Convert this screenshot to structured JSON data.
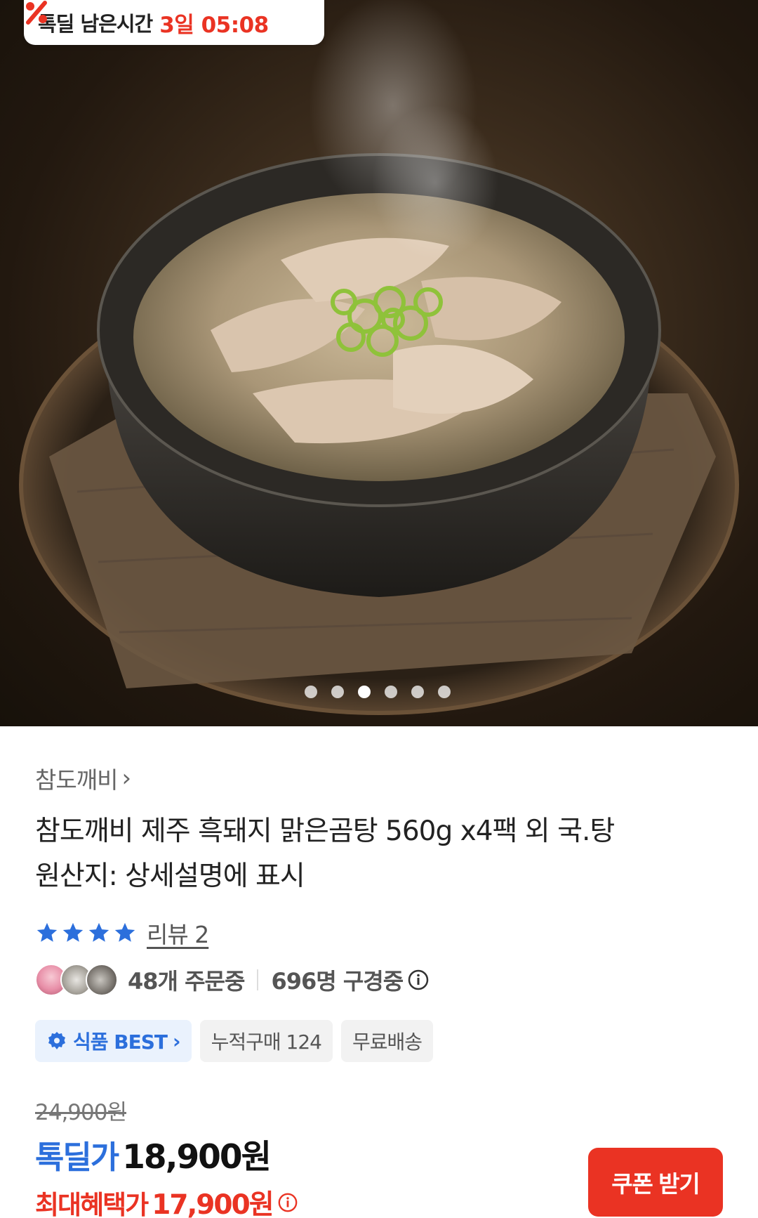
{
  "deal_timer": {
    "label": "톡딜 남은시간",
    "countdown": "3일 05:08",
    "icon": "percent-icon"
  },
  "carousel": {
    "image_alt": "clear pork soup with sliced pork and green onion in a dark bowl",
    "dot_count": 6,
    "active_index": 2
  },
  "product": {
    "seller": "참도깨비",
    "title": "참도깨비 제주 흑돼지 맑은곰탕 560g x4팩 외 국.탕",
    "origin": "원산지: 상세설명에 표시",
    "rating_stars": 4,
    "review_label": "리뷰 2"
  },
  "social_proof": {
    "orders": "48개 주문중",
    "viewers": "696명 구경중"
  },
  "badges": {
    "best": "식품 BEST",
    "cumulative": "누적구매 124",
    "shipping": "무료배송"
  },
  "pricing": {
    "original_price": "24,900원",
    "deal_label": "톡딜가",
    "deal_price": "18,900원",
    "benefit_label": "최대혜택가",
    "benefit_price": "17,900원",
    "coupon_button": "쿠폰 받기"
  },
  "colors": {
    "accent_red": "#ea3323",
    "accent_blue": "#2c6fdc"
  }
}
